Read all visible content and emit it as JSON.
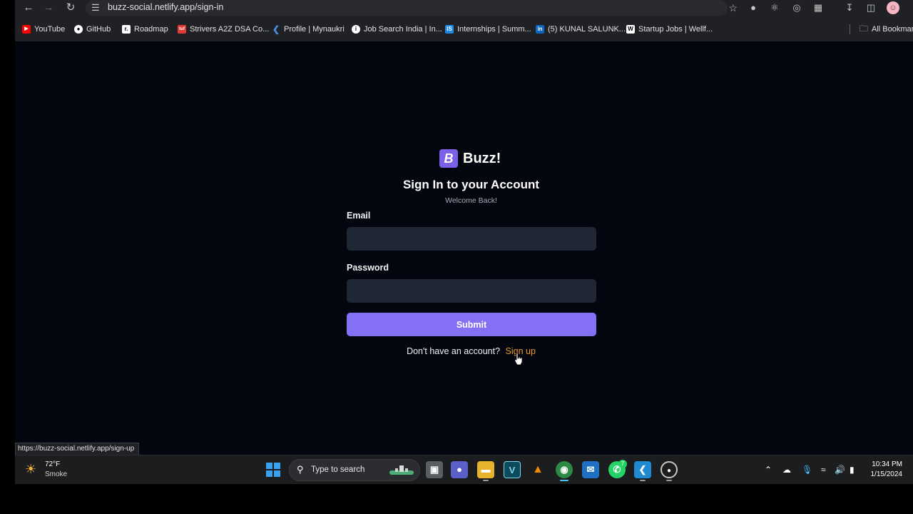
{
  "browser": {
    "url": "buzz-social.netlify.app/sign-in",
    "bookmarks": [
      {
        "label": "YouTube",
        "icon": "youtube-icon",
        "color": "#ff0000"
      },
      {
        "label": "GitHub",
        "icon": "github-icon",
        "color": "#ffffff"
      },
      {
        "label": "Roadmap",
        "icon": "roadmap-icon",
        "color": "#ffffff"
      },
      {
        "label": "Strivers A2Z DSA Co...",
        "icon": "tuf-icon",
        "color": "#e53935"
      },
      {
        "label": "Profile | Mynaukri",
        "icon": "naukri-icon",
        "color": "#4a90e2"
      },
      {
        "label": "Job Search India | In...",
        "icon": "info-icon",
        "color": "#ffffff"
      },
      {
        "label": "Internships | Summ...",
        "icon": "internshala-icon",
        "color": "#1e88e5"
      },
      {
        "label": "(5) KUNAL SALUNK...",
        "icon": "linkedin-icon",
        "color": "#0a66c2"
      },
      {
        "label": "Startup Jobs | Wellf...",
        "icon": "wellfound-icon",
        "color": "#ffffff"
      }
    ],
    "all_bookmarks_label": "All Bookmar",
    "status_url": "https://buzz-social.netlify.app/sign-up"
  },
  "page": {
    "logo_letter": "B",
    "brand": "Buzz!",
    "heading": "Sign In to your Account",
    "subheading": "Welcome Back!",
    "email_label": "Email",
    "email_value": "",
    "password_label": "Password",
    "password_value": "",
    "submit_label": "Submit",
    "signup_prompt": "Don't have an account?",
    "signup_link": "Sign up",
    "accent_color": "#8470f5",
    "link_color": "#e79d2c"
  },
  "taskbar": {
    "weather_temp": "72°F",
    "weather_condition": "Smoke",
    "search_placeholder": "Type to search",
    "whatsapp_badge": "7",
    "time": "10:34 PM",
    "date": "1/15/2024"
  }
}
